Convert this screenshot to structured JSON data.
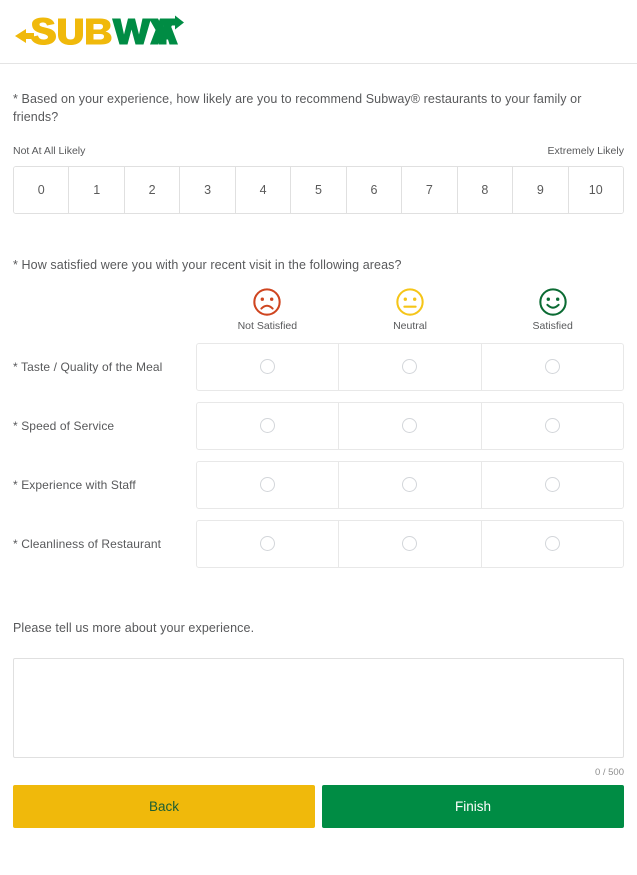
{
  "brand": {
    "logo_name": "subway-logo",
    "logo_text": "SUBWAY",
    "yellow": "#f0b90b",
    "green": "#008c44"
  },
  "nps": {
    "question": "* Based on your experience, how likely are you to recommend Subway® restaurants to your family or friends?",
    "low_label": "Not At All Likely",
    "high_label": "Extremely Likely",
    "options": [
      "0",
      "1",
      "2",
      "3",
      "4",
      "5",
      "6",
      "7",
      "8",
      "9",
      "10"
    ],
    "selected": null
  },
  "satisfaction": {
    "question": "* How satisfied were you with your recent visit in the following areas?",
    "columns": [
      {
        "label": "Not Satisfied",
        "icon": "frowning-face-icon",
        "color": "#cf4520"
      },
      {
        "label": "Neutral",
        "icon": "neutral-face-icon",
        "color": "#f5c518"
      },
      {
        "label": "Satisfied",
        "icon": "smiling-face-icon",
        "color": "#0b6b33"
      }
    ],
    "rows": [
      {
        "label": "* Taste / Quality of the Meal",
        "selected": null
      },
      {
        "label": "* Speed of Service",
        "selected": null
      },
      {
        "label": "* Experience with Staff",
        "selected": null
      },
      {
        "label": "* Cleanliness of Restaurant",
        "selected": null
      }
    ]
  },
  "comment": {
    "prompt": "Please tell us more about your experience.",
    "value": "",
    "placeholder": "",
    "char_count": "0 / 500"
  },
  "footer": {
    "back_label": "Back",
    "finish_label": "Finish"
  }
}
